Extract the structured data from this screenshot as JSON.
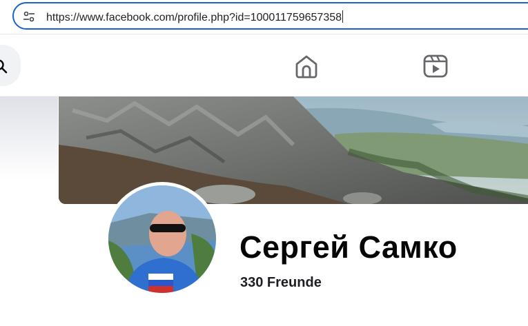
{
  "browser": {
    "url": "https://www.facebook.com/profile.php?id=100011759657358",
    "site_info_icon": "tune-icon"
  },
  "nav": {
    "search_icon": "search-icon",
    "items": [
      {
        "icon": "home-icon"
      },
      {
        "icon": "video-icon"
      }
    ]
  },
  "profile": {
    "name": "Сергей Самко",
    "friends": "330 Freunde"
  },
  "colors": {
    "accent": "#1a62c9",
    "nav_icon": "#65676b",
    "text": "#050505"
  }
}
